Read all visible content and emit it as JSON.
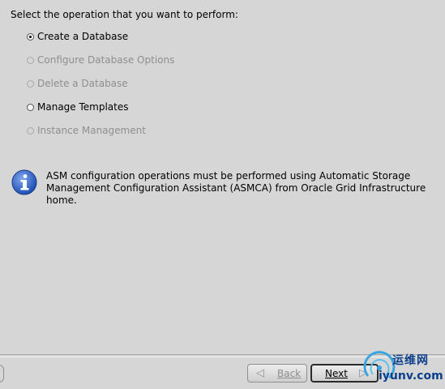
{
  "prompt": "Select the operation that you want to perform:",
  "options": [
    {
      "label": "Create a Database",
      "selected": true,
      "enabled": true
    },
    {
      "label": "Configure Database Options",
      "selected": false,
      "enabled": false
    },
    {
      "label": "Delete a Database",
      "selected": false,
      "enabled": false
    },
    {
      "label": "Manage Templates",
      "selected": false,
      "enabled": true
    },
    {
      "label": "Instance Management",
      "selected": false,
      "enabled": false
    }
  ],
  "info": {
    "icon": "info-icon",
    "line1": "ASM configuration operations must be performed using Automatic Storage",
    "line2": "Management Configuration Assistant (ASMCA) from Oracle Grid Infrastructure home."
  },
  "footer": {
    "back_label": "Back",
    "next_label": "Next"
  },
  "watermark": {
    "text_cn": "运维网",
    "text_en": "iyunv.com"
  },
  "colors": {
    "background": "#d6d6d6",
    "info_icon": "#2f63c8",
    "disabled_text": "#8f8f8f",
    "watermark": "#0b3f8a"
  }
}
